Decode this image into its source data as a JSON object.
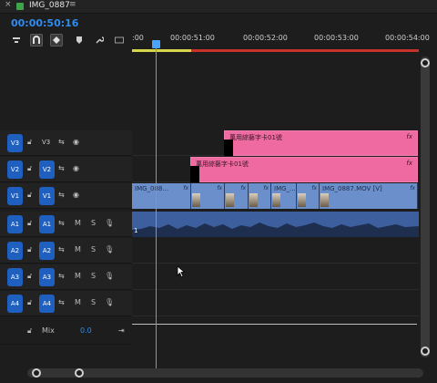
{
  "tab": {
    "close_glyph": "×",
    "title": "IMG_0887",
    "menu_glyph": "≡"
  },
  "timecode": "00:00:50:16",
  "ruler": {
    "ticks": [
      ":00",
      "00:00:51:00",
      "00:00:52:00",
      "00:00:53:00",
      "00:00:54:00"
    ]
  },
  "tools": [
    "snap-insert-icon",
    "magnet-icon",
    "linked-selection-icon",
    "marker-icon",
    "wrench-icon",
    "captions-icon"
  ],
  "tracks": [
    {
      "src": "V3",
      "name": "V3"
    },
    {
      "src": "V2",
      "name": "V2"
    },
    {
      "src": "V1",
      "name": "V1"
    },
    {
      "src": "A1",
      "name": "A1",
      "m": "M",
      "s": "S"
    },
    {
      "src": "A2",
      "name": "A2",
      "m": "M",
      "s": "S"
    },
    {
      "src": "A3",
      "name": "A3",
      "m": "M",
      "s": "S"
    },
    {
      "src": "A4",
      "name": "A4",
      "m": "M",
      "s": "S"
    }
  ],
  "mix": {
    "label": "Mix",
    "value": "0.0"
  },
  "clips": {
    "v3_title": "萬用綜藝字卡01號",
    "v2_title": "萬用綜藝字卡01號",
    "fx": "fx",
    "v1": [
      "IMG_088...",
      "IMG_...",
      "IMG_0887.MOV [V]"
    ],
    "audio_marker": "1"
  },
  "colors": {
    "accent": "#2e8bf0",
    "title_clip": "#ee6aa1",
    "video_clip": "#6b8fcb",
    "audio_clip": "#3d5f9e"
  }
}
